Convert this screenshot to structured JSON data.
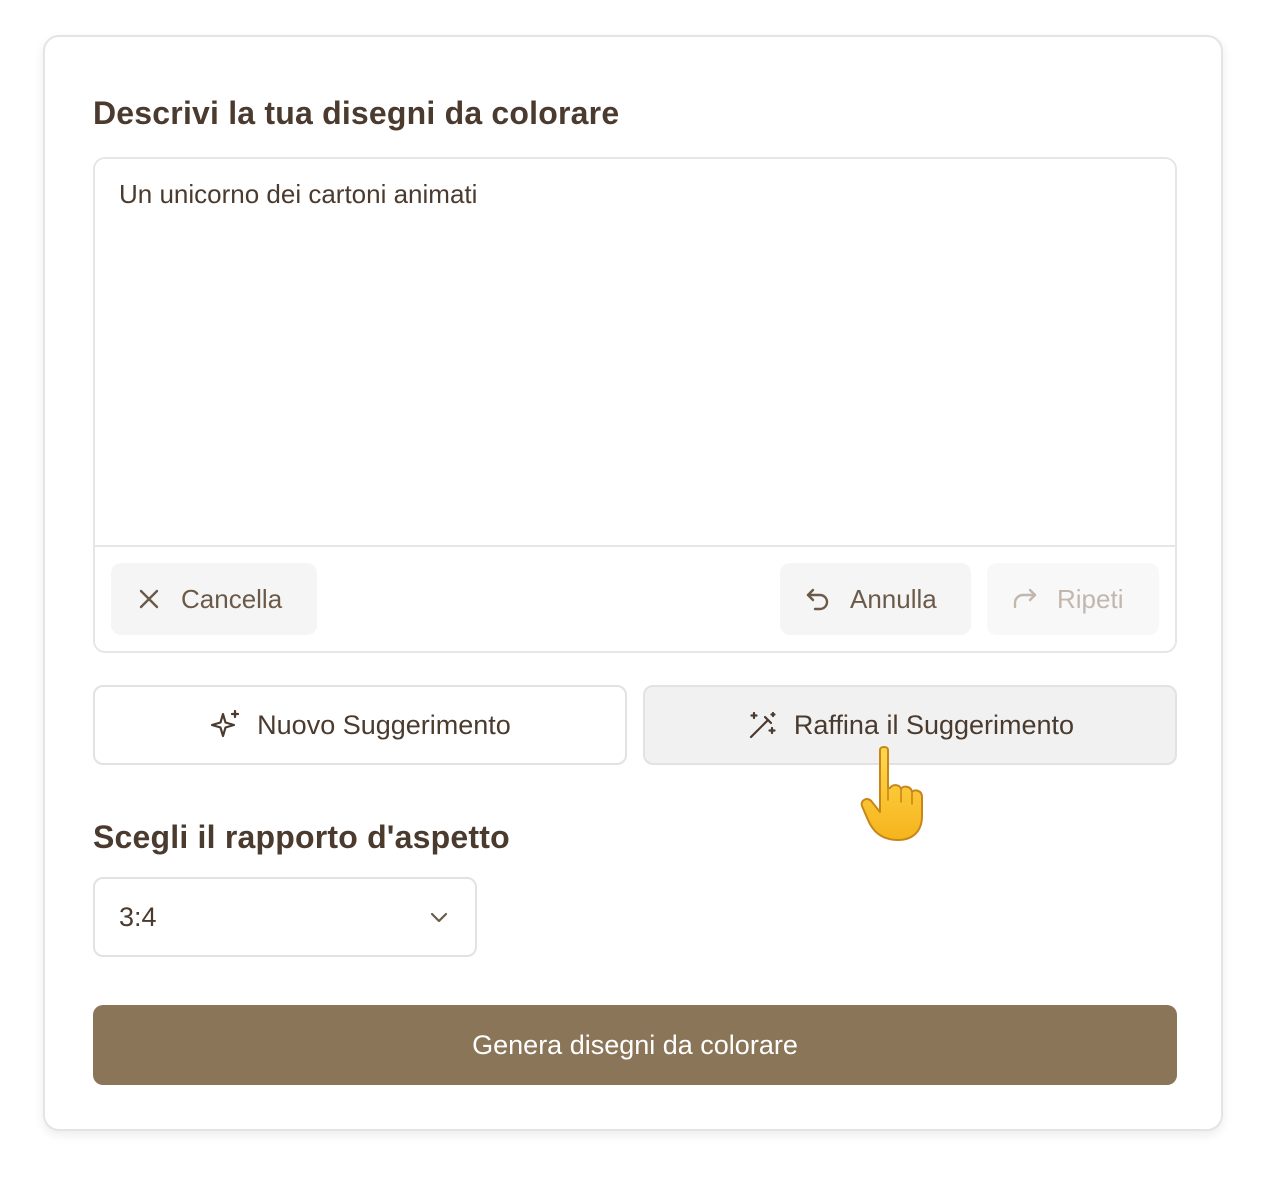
{
  "form": {
    "title": "Descrivi la tua disegni da colorare",
    "prompt_value": "Un unicorno dei cartoni animati",
    "clear_label": "Cancella",
    "undo_label": "Annulla",
    "redo_label": "Ripeti",
    "new_suggestion_label": "Nuovo Suggerimento",
    "refine_suggestion_label": "Raffina il Suggerimento",
    "aspect_title": "Scegli il rapporto d'aspetto",
    "aspect_value": "3:4",
    "generate_label": "Genera disegni da colorare"
  },
  "icons": {
    "clear": "close-icon",
    "undo": "undo-icon",
    "redo": "redo-icon",
    "new_suggestion": "sparkles-icon",
    "refine_suggestion": "magic-wand-icon",
    "dropdown": "chevron-down-icon",
    "cursor": "pointing-hand-cursor-icon"
  },
  "colors": {
    "text": "#4b3a2e",
    "primary_button": "#8a7558",
    "border": "#e2e2e2",
    "disabled_text": "#c2b7ad"
  }
}
